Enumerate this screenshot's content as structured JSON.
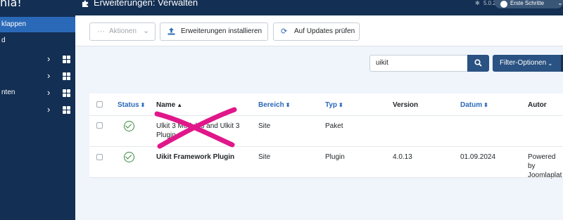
{
  "app": {
    "logo_text": "nla!"
  },
  "sidebar": {
    "toggle_label": "klappen",
    "items": [
      {
        "label": "d",
        "has_children": false,
        "has_grid": false
      },
      {
        "label": "",
        "has_children": true,
        "has_grid": true
      },
      {
        "label": "",
        "has_children": true,
        "has_grid": true
      },
      {
        "label": "nten",
        "has_children": true,
        "has_grid": true
      },
      {
        "label": "",
        "has_children": true,
        "has_grid": true
      }
    ]
  },
  "header": {
    "title": "Erweiterungen: Verwalten",
    "version": "5.0.2",
    "help_label": "Erste Schritte"
  },
  "toolbar": {
    "actions_label": "Aktionen",
    "install_label": "Erweiterungen installieren",
    "updates_label": "Auf Updates prüfen"
  },
  "search": {
    "value": "uikit",
    "filter_label": "Filter-Optionen"
  },
  "table": {
    "headers": {
      "status": "Status",
      "name": "Name",
      "bereich": "Bereich",
      "typ": "Typ",
      "version": "Version",
      "datum": "Datum",
      "autor": "Autor"
    },
    "rows": [
      {
        "name_line1": "Ulkit 3 Modules and Ulkit 3",
        "name_line2": "Plugin",
        "bereich": "Site",
        "typ": "Paket",
        "version": "",
        "datum": "",
        "autor_line1": "",
        "autor_line2": "",
        "status": "enabled"
      },
      {
        "name_line1": "Uikit Framework Plugin",
        "name_line2": "",
        "bereich": "Site",
        "typ": "Plugin",
        "version": "4.0.13",
        "datum": "01.09.2024",
        "autor_line1": "Powered by",
        "autor_line2": "Joomlaplat",
        "status": "enabled"
      }
    ]
  },
  "colors": {
    "navy": "#132f53",
    "accent_blue": "#2a69b8",
    "button_blue": "#2a5282",
    "success_green": "#3a8a3e",
    "annotation_magenta": "#e0178a"
  }
}
